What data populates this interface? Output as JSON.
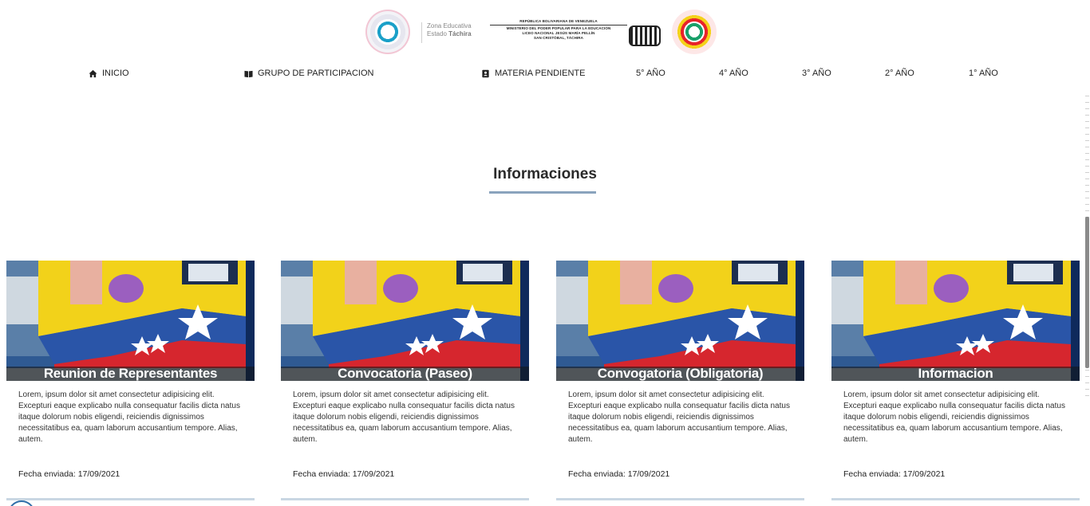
{
  "header": {
    "zona_line1": "Zona Educativa",
    "zona_line2_prefix": "Estado ",
    "zona_line2_bold": "Táchira",
    "ministry_lines": [
      "REPÚBLICA BOLIVARIANA DE VENEZUELA",
      "MINISTERIO DEL PODER POPULAR PARA LA EDUCACIÓN",
      "LICEO NACIONAL JESÚS MARÍA PELLÍN",
      "SAN CRISTÓBAL, TÁCHIRA"
    ]
  },
  "nav": {
    "items": [
      {
        "label": "INICIO",
        "icon": "home-icon"
      },
      {
        "label": "GRUPO DE PARTICIPACION",
        "icon": "book-icon"
      },
      {
        "label": "MATERIA PENDIENTE",
        "icon": "contact-book-icon"
      },
      {
        "label": "5° AÑO",
        "icon": ""
      },
      {
        "label": "4° AÑO",
        "icon": ""
      },
      {
        "label": "3° AÑO",
        "icon": ""
      },
      {
        "label": "2° AÑO",
        "icon": ""
      },
      {
        "label": "1° AÑO",
        "icon": ""
      }
    ]
  },
  "section": {
    "title": "Informaciones"
  },
  "cards": [
    {
      "title": "Reunion de Representantes",
      "text": "Lorem, ipsum dolor sit amet consectetur adipisicing elit. Excepturi eaque explicabo nulla consequatur facilis dicta natus itaque dolorum nobis eligendi, reiciendis dignissimos necessitatibus ea, quam laborum accusantium tempore. Alias, autem.",
      "date": "Fecha enviada: 17/09/2021"
    },
    {
      "title": "Convocatoria (Paseo)",
      "text": "Lorem, ipsum dolor sit amet consectetur adipisicing elit. Excepturi eaque explicabo nulla consequatur facilis dicta natus itaque dolorum nobis eligendi, reiciendis dignissimos necessitatibus ea, quam laborum accusantium tempore. Alias, autem.",
      "date": "Fecha enviada: 17/09/2021"
    },
    {
      "title": "Convogatoria (Obligatoria)",
      "text": "Lorem, ipsum dolor sit amet consectetur adipisicing elit. Excepturi eaque explicabo nulla consequatur facilis dicta natus itaque dolorum nobis eligendi, reiciendis dignissimos necessitatibus ea, quam laborum accusantium tempore. Alias, autem.",
      "date": "Fecha enviada: 17/09/2021"
    },
    {
      "title": "Informacion",
      "text": "Lorem, ipsum dolor sit amet consectetur adipisicing elit. Excepturi eaque explicabo nulla consequatur facilis dicta natus itaque dolorum nobis eligendi, reiciendis dignissimos necessitatibus ea, quam laborum accusantium tempore. Alias, autem.",
      "date": "Fecha enviada: 17/09/2021"
    }
  ],
  "colors": {
    "title_underline": "#8aa3bd",
    "card_rule": "#c9d7e3",
    "caption_overlay": "#141414"
  }
}
